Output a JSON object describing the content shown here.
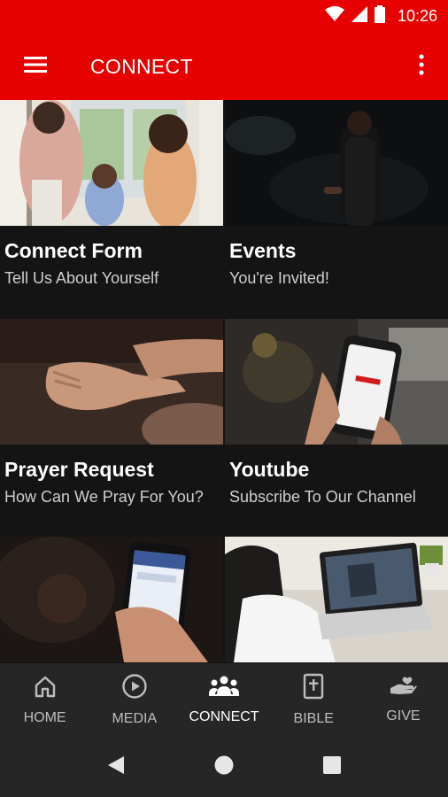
{
  "status_bar": {
    "time": "10:26"
  },
  "app_bar": {
    "title": "CONNECT"
  },
  "tiles": [
    {
      "title": "Connect Form",
      "subtitle": "Tell Us About Yourself"
    },
    {
      "title": "Events",
      "subtitle": "You're Invited!"
    },
    {
      "title": "Prayer Request",
      "subtitle": "How Can We Pray For You?"
    },
    {
      "title": "Youtube",
      "subtitle": "Subscribe To Our Channel"
    }
  ],
  "bottom_nav": {
    "active": "CONNECT",
    "items": [
      {
        "label": "HOME",
        "icon": "home-icon"
      },
      {
        "label": "MEDIA",
        "icon": "play-circle-icon"
      },
      {
        "label": "CONNECT",
        "icon": "people-icon"
      },
      {
        "label": "BIBLE",
        "icon": "bible-icon"
      },
      {
        "label": "GIVE",
        "icon": "give-hand-icon"
      }
    ]
  },
  "colors": {
    "brand_red": "#e60000",
    "background": "#141414",
    "nav_background": "#262626"
  }
}
